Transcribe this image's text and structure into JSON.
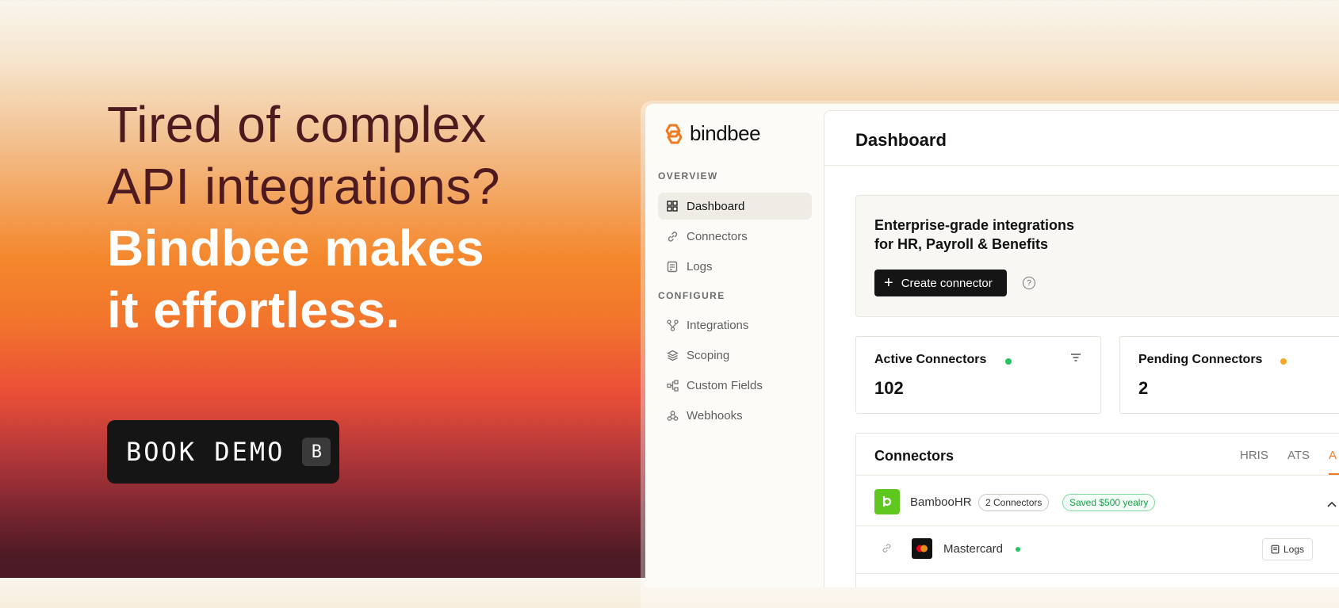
{
  "hero": {
    "line1": "Tired of complex",
    "line2": "API integrations?",
    "line3": "Bindbee makes",
    "line4": "it effortless."
  },
  "cta": {
    "label": "BOOK DEMO",
    "shortcut": "B"
  },
  "app": {
    "brand": "bindbee",
    "sidebar": {
      "overview_label": "OVERVIEW",
      "configure_label": "CONFIGURE",
      "items": [
        {
          "label": "Dashboard",
          "icon": "grid-icon"
        },
        {
          "label": "Connectors",
          "icon": "link-icon"
        },
        {
          "label": "Logs",
          "icon": "document-icon"
        },
        {
          "label": "Integrations",
          "icon": "branch-icon"
        },
        {
          "label": "Scoping",
          "icon": "layers-icon"
        },
        {
          "label": "Custom Fields",
          "icon": "hierarchy-icon"
        },
        {
          "label": "Webhooks",
          "icon": "webhook-icon"
        }
      ]
    },
    "header": {
      "title": "Dashboard"
    },
    "banner": {
      "line1": "Enterprise-grade integrations",
      "line2": "for HR, Payroll & Benefits",
      "button": "Create connector"
    },
    "stats": [
      {
        "label": "Active Connectors",
        "value": "102",
        "dot_color": "#22c55e"
      },
      {
        "label": "Pending Connectors",
        "value": "2",
        "dot_color": "#f5a623"
      }
    ],
    "connectors": {
      "title": "Connectors",
      "tabs": [
        "HRIS",
        "ATS",
        "A"
      ],
      "rows": [
        {
          "name": "BambooHR",
          "badge": "2 Connectors",
          "saving": "Saved $500 yealry"
        },
        {
          "name": "Mastercard",
          "action": "Logs"
        }
      ]
    },
    "colors": {
      "accent": "#f07a22",
      "dark": "#151515",
      "green": "#22c55e"
    }
  }
}
